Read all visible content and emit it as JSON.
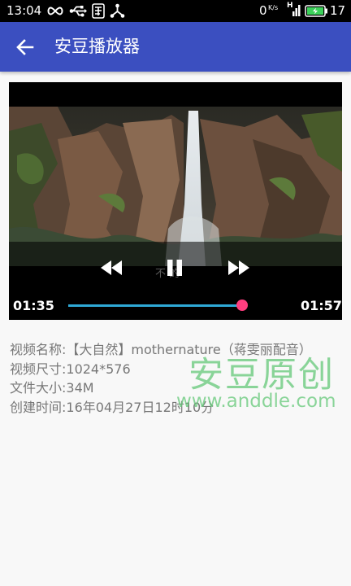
{
  "status_bar": {
    "time": "13:04",
    "network_speed": "0",
    "network_unit": "K/s",
    "network_type": "H",
    "battery_level": "17",
    "icons": [
      "infinity-icon",
      "usb-icon",
      "app-notification-icon",
      "share-icon",
      "signal-icon",
      "battery-icon"
    ]
  },
  "app_bar": {
    "title": "安豆播放器",
    "back_icon": "arrow-left-icon",
    "background": "#3b4fc0"
  },
  "player": {
    "current_time": "01:35",
    "total_time": "01:57",
    "subtitle_text": "不     的",
    "progress": 0.81,
    "seek_color": "#2fa9d6",
    "thumb_color": "#ff3e7f",
    "controls": [
      "rewind-icon",
      "pause-icon",
      "fast-forward-icon"
    ]
  },
  "video_info": {
    "name": "视频名称:【大自然】mothernature（蒋雯丽配音）",
    "size": "视频尺寸:1024*576",
    "file_size": "文件大小:34M",
    "created": "创建时间:16年04月27日12时10分"
  },
  "watermark": {
    "title": "安豆原创",
    "url": "www.anddle.com"
  }
}
